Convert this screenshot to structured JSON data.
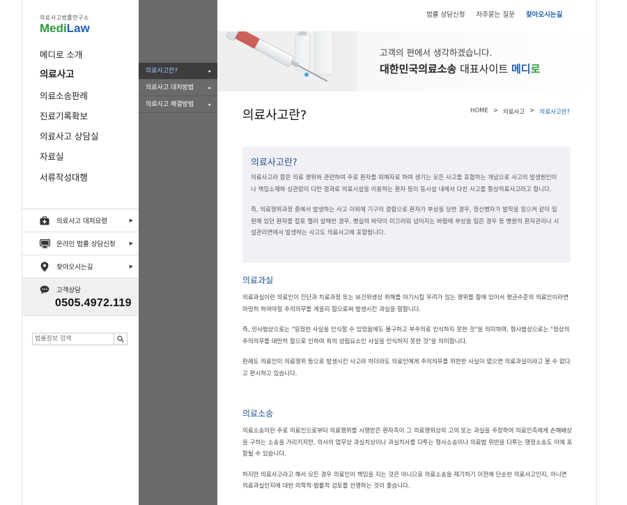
{
  "logo": {
    "sub": "의료사고법률연구소",
    "main_a": "Medi",
    "main_b": "Law"
  },
  "main_menu": [
    {
      "label": "메디로 소개"
    },
    {
      "label": "의료사고"
    },
    {
      "label": "의료소송판례"
    },
    {
      "label": "진료기록확보"
    },
    {
      "label": "의료사고 상담실"
    },
    {
      "label": "자료실"
    },
    {
      "label": "서류작성대행"
    }
  ],
  "quick_links": [
    {
      "label": "의료사고 대처요령",
      "icon": "first-aid-kit-icon"
    },
    {
      "label": "온라인 법률 상담신청",
      "icon": "monitor-icon"
    },
    {
      "label": "찾아오시는길",
      "icon": "location-pin-icon"
    }
  ],
  "contact": {
    "label": "고객상담",
    "phone": "0505.4972.119",
    "icon": "speech-bubble-icon"
  },
  "search": {
    "placeholder": "법률정보 검색"
  },
  "sub_menu": [
    {
      "label": "의료사고란?"
    },
    {
      "label": "의료사고 대처방법"
    },
    {
      "label": "의료사고 해결방법"
    }
  ],
  "top_nav": [
    {
      "label": "법률 상담신청"
    },
    {
      "label": "자주묻는 질문"
    },
    {
      "label": "찾아오시는길"
    }
  ],
  "banner": {
    "line1": "고객의 편에서 생각하겠습니다.",
    "line2_bold": "대한민국의료소송",
    "line2_normal": " 대표사이트 ",
    "brand_a": "메디",
    "brand_b": "로"
  },
  "page": {
    "title": "의료사고란?",
    "breadcrumb": [
      "HOME",
      "의료사고",
      "의료사고란?"
    ]
  },
  "intro": {
    "heading": "의료사고란?",
    "p1": "의료사고라 함은 의료 행위와 관련하여 주로 환자를 피해자로 하여 생기는 모든 사고를 포함하는 개념으로 사고의 발생원인이나 책임소재와 상관없이 다만 결과로 의료시설을 이용하는 환자 등이 동시설 내에서 다친 사고를 통상의료사고라고 합니다.",
    "p2": "즉, 의료행위과정 중에서 발생하는 사고 이외에 기구의 결함으로 환자가 부상을 당한 경우, 정신병자가 발작을 일으켜 같이 입원해 있던 환자를 칼로 찔러 살해한 경우, 병실의 바닥이 미끄러워 넘어지는 바람에 부상을 입은 경우 등 병원의 환자관리나 시설관리면에서 발생하는 사고도 의료사고에 포함됩니다."
  },
  "sections": [
    {
      "heading": "의료과실",
      "paragraphs": [
        "의료과실이란 의료인이 진단과 치료과정 또는 보건위생상 위해를 야기시킬 우려가 있는 행위를 함에 있어서 평균수준의 의료인이라면 마땅히 하여야할 주의의무를 게을리 함으로써 발생시킨 과실을 말합니다.",
        "즉, 민사법상으로는 \"일정한 사실을 인식할 수 있었음에도 불구하고 부주의로 인식하지 못한 것\"을 의미하며, 형사법상으로는 \"정상의 주의의무를 태만히 함으로 인하여 죄의 성립요소인 사실을 인식하지 못한 것\"을 의미합니다.",
        "판례도 의료인이 의료행위 등으로 발생시킨 사고라 하더라도 의료인에게 주의의무를 위반한 사실이 없으면 의료과실이라고 볼 수 없다고 판시하고 있습니다."
      ]
    },
    {
      "heading": "의료소송",
      "paragraphs": [
        "의료소송이란 주로 의료인으로부터 의료행위를 시행받은 환자측이 그 의료행위상의 고의 또는 과실을 주장하여 의료인측에게 손해배상을 구하는 소송을 가리키지만, 의사의 업무상 과실치상이나 과실치사를 다투는 형사소송이나 의료법 위반을 다투는 행정소송도 이에 포함될 수 있습니다.",
        "하지만 의료사고라고 해서 모든 경우 의료인이 책임을 지는 것은 아니므로 의료소송을 제기하기 이전에 단순한 의료사고인지, 아니면 의료과실인지에 대한 의학적·법률적 검토를 선행하는 것이 좋습니다."
      ]
    }
  ],
  "colors": {
    "accent": "#1f5fb0",
    "logo_green": "#2a9a3a",
    "submenu_bg": "#6a6a6a",
    "submenu_active": "#3d3d3d"
  }
}
